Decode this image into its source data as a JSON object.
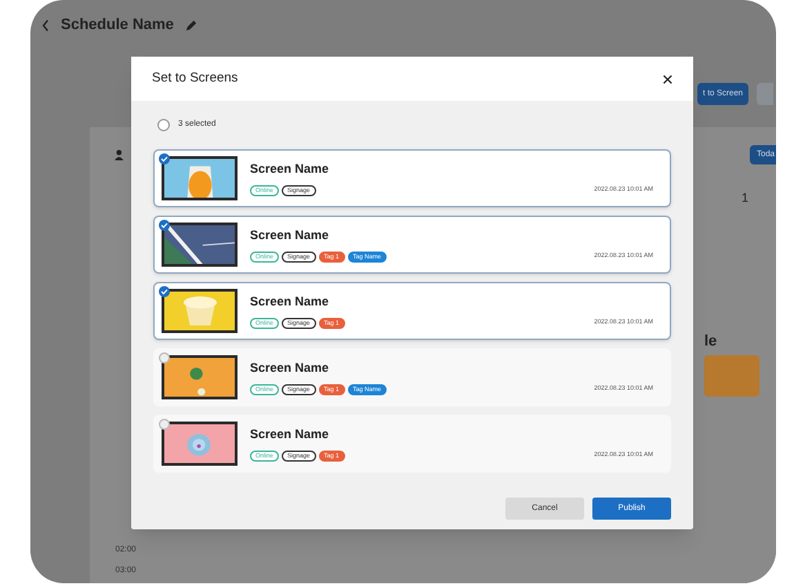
{
  "header": {
    "title": "Schedule Name"
  },
  "background": {
    "button": "t to Screen",
    "today": "Toda",
    "day": "1",
    "event_title": "le",
    "times": [
      "02:00",
      "03:00"
    ]
  },
  "dialog": {
    "title": "Set to Screens",
    "select_all": {
      "label": "3 selected",
      "checked": false
    },
    "screens": [
      {
        "name": "Screen Name",
        "selected": true,
        "tags": [
          {
            "label": "Online",
            "kind": "status"
          },
          {
            "label": "Signage",
            "kind": "type"
          }
        ],
        "date": "2022.08.23 10:01 AM"
      },
      {
        "name": "Screen Name",
        "selected": true,
        "tags": [
          {
            "label": "Online",
            "kind": "status"
          },
          {
            "label": "Signage",
            "kind": "type"
          },
          {
            "label": "Tag 1",
            "kind": "tag"
          },
          {
            "label": "Tag Name",
            "kind": "name"
          }
        ],
        "date": "2022.08.23 10:01 AM"
      },
      {
        "name": "Screen Name",
        "selected": true,
        "tags": [
          {
            "label": "Online",
            "kind": "status"
          },
          {
            "label": "Signage",
            "kind": "type"
          },
          {
            "label": "Tag 1",
            "kind": "tag"
          }
        ],
        "date": "2022.08.23 10:01 AM"
      },
      {
        "name": "Screen Name",
        "selected": false,
        "tags": [
          {
            "label": "Online",
            "kind": "status"
          },
          {
            "label": "Signage",
            "kind": "type"
          },
          {
            "label": "Tag 1",
            "kind": "tag"
          },
          {
            "label": "Tag Name",
            "kind": "name"
          }
        ],
        "date": "2022.08.23 10:01 AM"
      },
      {
        "name": "Screen Name",
        "selected": false,
        "tags": [
          {
            "label": "Online",
            "kind": "status"
          },
          {
            "label": "Signage",
            "kind": "type"
          },
          {
            "label": "Tag 1",
            "kind": "tag"
          }
        ],
        "date": "2022.08.23 10:01 AM"
      }
    ],
    "buttons": [
      {
        "label": "Cancel",
        "kind": "secondary"
      },
      {
        "label": "Publish",
        "kind": "primary"
      }
    ]
  }
}
